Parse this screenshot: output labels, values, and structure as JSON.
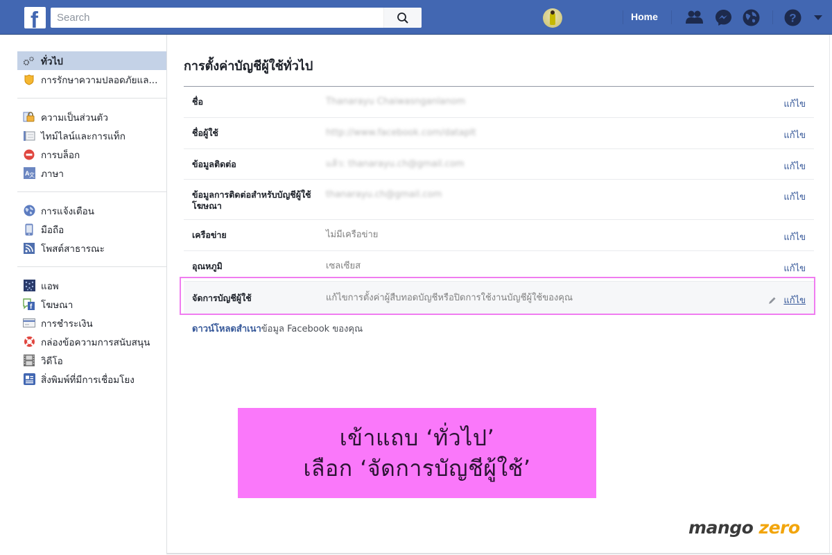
{
  "topbar": {
    "search_placeholder": "Search",
    "home_label": "Home",
    "icons": [
      "facebook-logo",
      "search-icon",
      "profile-avatar",
      "friend-requests-icon",
      "messenger-icon",
      "notifications-globe-icon",
      "help-icon",
      "account-menu-caret"
    ]
  },
  "sidebar": {
    "groups": [
      [
        {
          "label": "ทั่วไป",
          "icon": "gears-icon",
          "active": true
        },
        {
          "label": "การรักษาความปลอดภัยแล...",
          "icon": "shield-icon"
        }
      ],
      [
        {
          "label": "ความเป็นส่วนตัว",
          "icon": "lock-icon"
        },
        {
          "label": "ไทม์ไลน์และการแท็ก",
          "icon": "timeline-icon"
        },
        {
          "label": "การบล็อก",
          "icon": "block-icon"
        },
        {
          "label": "ภาษา",
          "icon": "language-icon"
        }
      ],
      [
        {
          "label": "การแจ้งเตือน",
          "icon": "globe-icon"
        },
        {
          "label": "มือถือ",
          "icon": "mobile-icon"
        },
        {
          "label": "โพสต์สาธารณะ",
          "icon": "rss-icon"
        }
      ],
      [
        {
          "label": "แอพ",
          "icon": "apps-icon"
        },
        {
          "label": "โฆษณา",
          "icon": "ads-icon"
        },
        {
          "label": "การชำระเงิน",
          "icon": "credit-card-icon"
        },
        {
          "label": "กล่องข้อความการสนับสนุน",
          "icon": "lifebuoy-icon"
        },
        {
          "label": "วิดีโอ",
          "icon": "film-icon"
        },
        {
          "label": "สิ่งพิมพ์ที่มีการเชื่อมโยง",
          "icon": "news-icon"
        }
      ]
    ]
  },
  "main": {
    "title": "การตั้งค่าบัญชีผู้ใช้ทั่วไป",
    "edit_label": "แก้ไข",
    "rows": [
      {
        "label": "ชื่อ",
        "value": "Thanarayu Chaiwasnganlanom",
        "blurred": true
      },
      {
        "label": "ชื่อผู้ใช้",
        "value": "http://www.facebook.com/dataplt",
        "blurred": true
      },
      {
        "label": "ข้อมูลติดต่อ",
        "value": "แล้ว: thanarayu.ch@gmail.com",
        "blurred": true
      },
      {
        "label": "ข้อมูลการติดต่อสำหรับบัญชีผู้ใช้โฆษณา",
        "value": "thanarayu.ch@gmail.com",
        "blurred": true
      },
      {
        "label": "เครือข่าย",
        "value": "ไม่มีเครือข่าย",
        "blurred": false
      },
      {
        "label": "อุณหภูมิ",
        "value": "เซลเซียส",
        "blurred": false
      },
      {
        "label": "จัดการบัญชีผู้ใช้",
        "value": "แก้ไขการตั้งค่าผู้สืบทอดบัญชีหรือปิดการใช้งานบัญชีผู้ใช้ของคุณ",
        "blurred": false,
        "highlighted": true
      }
    ],
    "download_link": "ดาวน์โหลดสำเนา",
    "download_text": "ข้อมูล Facebook ของคุณ"
  },
  "annotation": {
    "line1": "เข้าแถบ ‘ทั่วไป’",
    "line2": "เลือก ‘จัดการบัญชีผู้ใช้’",
    "bg_color": "#fa78fa",
    "highlight_border_color": "#f07cf0"
  },
  "watermark": {
    "part1": "mango",
    "part2": "zero",
    "accent_color": "#f2a50c"
  },
  "colors": {
    "brand_blue": "#4267b2",
    "link_blue": "#365899",
    "active_item_bg": "#c4d2e7"
  }
}
